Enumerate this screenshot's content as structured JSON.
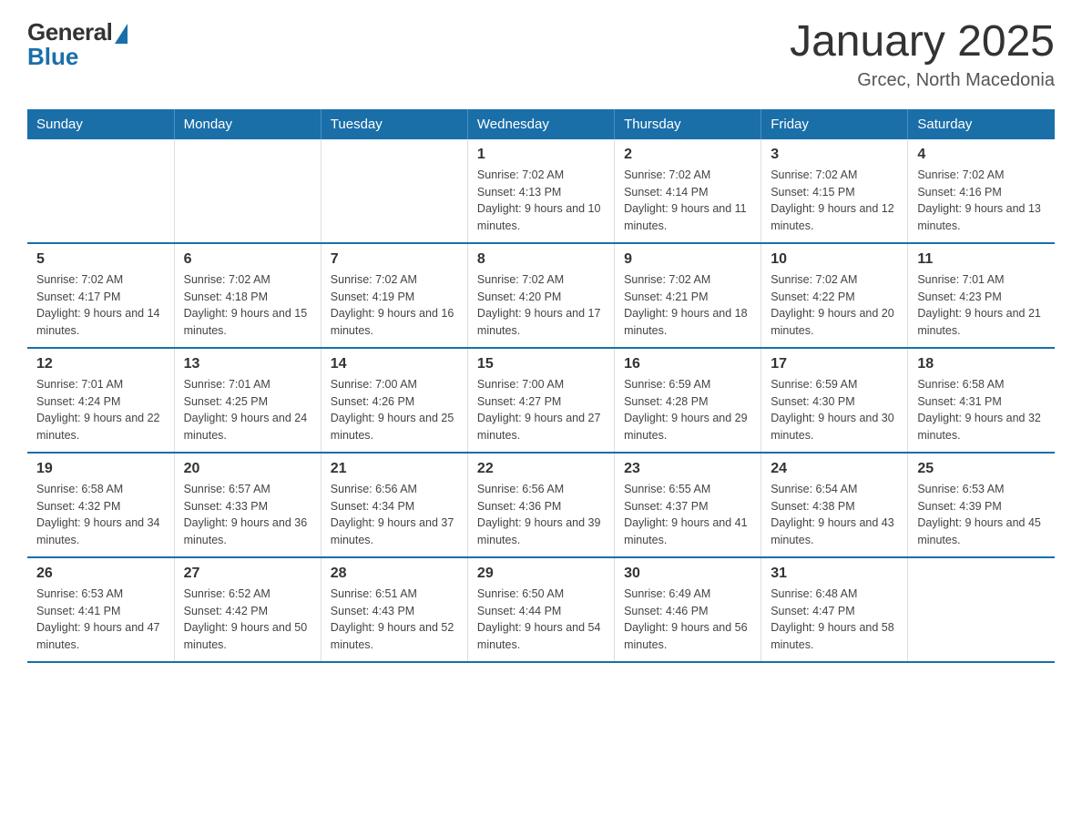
{
  "logo": {
    "general": "General",
    "blue": "Blue"
  },
  "title": "January 2025",
  "subtitle": "Grcec, North Macedonia",
  "days_of_week": [
    "Sunday",
    "Monday",
    "Tuesday",
    "Wednesday",
    "Thursday",
    "Friday",
    "Saturday"
  ],
  "weeks": [
    [
      {
        "day": "",
        "info": ""
      },
      {
        "day": "",
        "info": ""
      },
      {
        "day": "",
        "info": ""
      },
      {
        "day": "1",
        "info": "Sunrise: 7:02 AM\nSunset: 4:13 PM\nDaylight: 9 hours and 10 minutes."
      },
      {
        "day": "2",
        "info": "Sunrise: 7:02 AM\nSunset: 4:14 PM\nDaylight: 9 hours and 11 minutes."
      },
      {
        "day": "3",
        "info": "Sunrise: 7:02 AM\nSunset: 4:15 PM\nDaylight: 9 hours and 12 minutes."
      },
      {
        "day": "4",
        "info": "Sunrise: 7:02 AM\nSunset: 4:16 PM\nDaylight: 9 hours and 13 minutes."
      }
    ],
    [
      {
        "day": "5",
        "info": "Sunrise: 7:02 AM\nSunset: 4:17 PM\nDaylight: 9 hours and 14 minutes."
      },
      {
        "day": "6",
        "info": "Sunrise: 7:02 AM\nSunset: 4:18 PM\nDaylight: 9 hours and 15 minutes."
      },
      {
        "day": "7",
        "info": "Sunrise: 7:02 AM\nSunset: 4:19 PM\nDaylight: 9 hours and 16 minutes."
      },
      {
        "day": "8",
        "info": "Sunrise: 7:02 AM\nSunset: 4:20 PM\nDaylight: 9 hours and 17 minutes."
      },
      {
        "day": "9",
        "info": "Sunrise: 7:02 AM\nSunset: 4:21 PM\nDaylight: 9 hours and 18 minutes."
      },
      {
        "day": "10",
        "info": "Sunrise: 7:02 AM\nSunset: 4:22 PM\nDaylight: 9 hours and 20 minutes."
      },
      {
        "day": "11",
        "info": "Sunrise: 7:01 AM\nSunset: 4:23 PM\nDaylight: 9 hours and 21 minutes."
      }
    ],
    [
      {
        "day": "12",
        "info": "Sunrise: 7:01 AM\nSunset: 4:24 PM\nDaylight: 9 hours and 22 minutes."
      },
      {
        "day": "13",
        "info": "Sunrise: 7:01 AM\nSunset: 4:25 PM\nDaylight: 9 hours and 24 minutes."
      },
      {
        "day": "14",
        "info": "Sunrise: 7:00 AM\nSunset: 4:26 PM\nDaylight: 9 hours and 25 minutes."
      },
      {
        "day": "15",
        "info": "Sunrise: 7:00 AM\nSunset: 4:27 PM\nDaylight: 9 hours and 27 minutes."
      },
      {
        "day": "16",
        "info": "Sunrise: 6:59 AM\nSunset: 4:28 PM\nDaylight: 9 hours and 29 minutes."
      },
      {
        "day": "17",
        "info": "Sunrise: 6:59 AM\nSunset: 4:30 PM\nDaylight: 9 hours and 30 minutes."
      },
      {
        "day": "18",
        "info": "Sunrise: 6:58 AM\nSunset: 4:31 PM\nDaylight: 9 hours and 32 minutes."
      }
    ],
    [
      {
        "day": "19",
        "info": "Sunrise: 6:58 AM\nSunset: 4:32 PM\nDaylight: 9 hours and 34 minutes."
      },
      {
        "day": "20",
        "info": "Sunrise: 6:57 AM\nSunset: 4:33 PM\nDaylight: 9 hours and 36 minutes."
      },
      {
        "day": "21",
        "info": "Sunrise: 6:56 AM\nSunset: 4:34 PM\nDaylight: 9 hours and 37 minutes."
      },
      {
        "day": "22",
        "info": "Sunrise: 6:56 AM\nSunset: 4:36 PM\nDaylight: 9 hours and 39 minutes."
      },
      {
        "day": "23",
        "info": "Sunrise: 6:55 AM\nSunset: 4:37 PM\nDaylight: 9 hours and 41 minutes."
      },
      {
        "day": "24",
        "info": "Sunrise: 6:54 AM\nSunset: 4:38 PM\nDaylight: 9 hours and 43 minutes."
      },
      {
        "day": "25",
        "info": "Sunrise: 6:53 AM\nSunset: 4:39 PM\nDaylight: 9 hours and 45 minutes."
      }
    ],
    [
      {
        "day": "26",
        "info": "Sunrise: 6:53 AM\nSunset: 4:41 PM\nDaylight: 9 hours and 47 minutes."
      },
      {
        "day": "27",
        "info": "Sunrise: 6:52 AM\nSunset: 4:42 PM\nDaylight: 9 hours and 50 minutes."
      },
      {
        "day": "28",
        "info": "Sunrise: 6:51 AM\nSunset: 4:43 PM\nDaylight: 9 hours and 52 minutes."
      },
      {
        "day": "29",
        "info": "Sunrise: 6:50 AM\nSunset: 4:44 PM\nDaylight: 9 hours and 54 minutes."
      },
      {
        "day": "30",
        "info": "Sunrise: 6:49 AM\nSunset: 4:46 PM\nDaylight: 9 hours and 56 minutes."
      },
      {
        "day": "31",
        "info": "Sunrise: 6:48 AM\nSunset: 4:47 PM\nDaylight: 9 hours and 58 minutes."
      },
      {
        "day": "",
        "info": ""
      }
    ]
  ]
}
